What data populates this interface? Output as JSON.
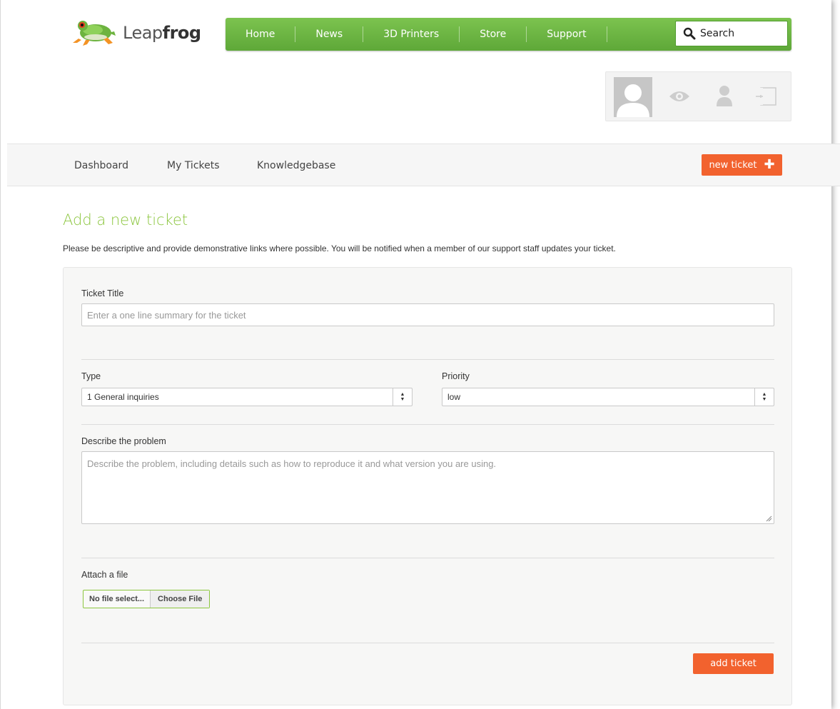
{
  "brand": {
    "name_light": "Leap",
    "name_bold": "frog",
    "accent_green": "#7cc34f",
    "accent_orange": "#f2622e"
  },
  "topnav": {
    "items": [
      "Home",
      "News",
      "3D Printers",
      "Store",
      "Support"
    ],
    "search_label": "Search"
  },
  "user_panel": {
    "icons": [
      "avatar",
      "eye-icon",
      "user-icon",
      "logout-icon"
    ]
  },
  "subnav": {
    "links": [
      "Dashboard",
      "My Tickets",
      "Knowledgebase"
    ],
    "new_ticket_label": "new ticket"
  },
  "page": {
    "title": "Add a new ticket",
    "description": "Please be descriptive and provide demonstrative links where possible. You will be notified when a member of our support staff updates your ticket."
  },
  "form": {
    "ticket_title_label": "Ticket Title",
    "ticket_title_placeholder": "Enter a one line summary for the ticket",
    "type_label": "Type",
    "type_value": "1 General inquiries",
    "priority_label": "Priority",
    "priority_value": "low",
    "problem_label": "Describe the problem",
    "problem_placeholder": "Describe the problem, including details such as how to reproduce it and what version you are using.",
    "attach_label": "Attach a file",
    "file_status": "No file select...",
    "choose_file_label": "Choose File",
    "submit_label": "add ticket"
  }
}
